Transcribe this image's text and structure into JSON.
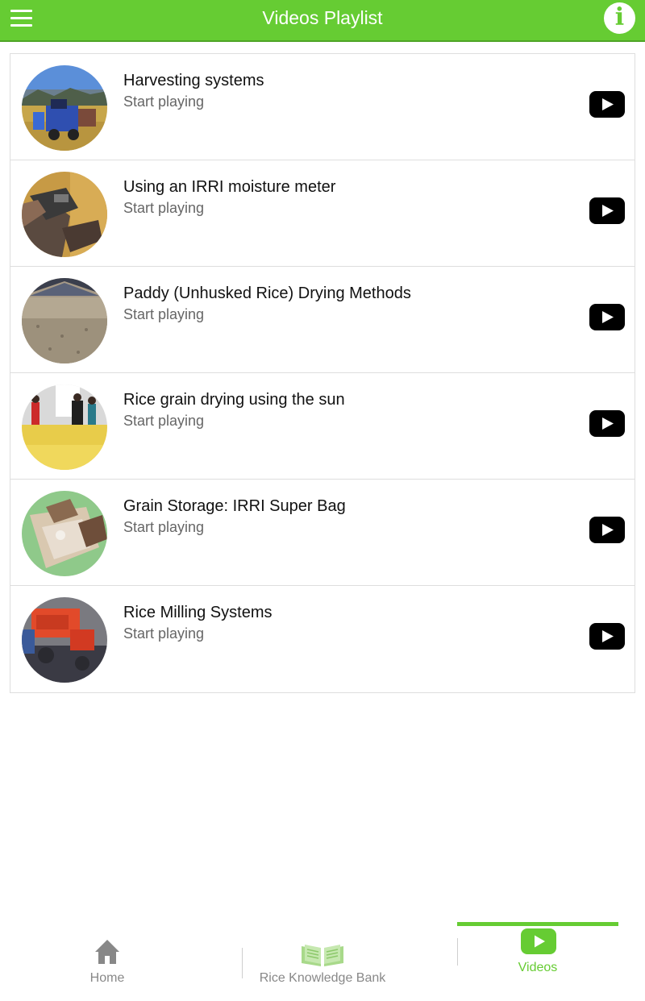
{
  "header": {
    "title": "Videos Playlist",
    "menu_icon": "hamburger-menu-icon",
    "info_icon": "info-icon",
    "info_glyph": "i",
    "background_color": "#66cc33"
  },
  "playlist": {
    "items": [
      {
        "title": "Harvesting systems",
        "subtitle": "Start playing",
        "thumbnail": "harvester-machine-in-field"
      },
      {
        "title": "Using an IRRI moisture meter",
        "subtitle": "Start playing",
        "thumbnail": "hand-with-moisture-meter"
      },
      {
        "title": "Paddy (Unhusked Rice) Drying Methods",
        "subtitle": "Start playing",
        "thumbnail": "paddy-grain-pile"
      },
      {
        "title": "Rice grain drying using the sun",
        "subtitle": "Start playing",
        "thumbnail": "people-drying-rice-outdoors"
      },
      {
        "title": "Grain Storage: IRRI Super Bag",
        "subtitle": "Start playing",
        "thumbnail": "hands-holding-super-bag"
      },
      {
        "title": "Rice Milling Systems",
        "subtitle": "Start playing",
        "thumbnail": "red-rice-mill-machine"
      }
    ],
    "play_icon": "youtube-play-icon"
  },
  "bottom_nav": {
    "tabs": [
      {
        "label": "Home",
        "icon": "home-icon",
        "active": false
      },
      {
        "label": "Rice Knowledge Bank",
        "icon": "open-book-icon",
        "active": false
      },
      {
        "label": "Videos",
        "icon": "youtube-play-icon",
        "active": true
      }
    ],
    "active_color": "#66cc33",
    "inactive_color": "#888888"
  }
}
